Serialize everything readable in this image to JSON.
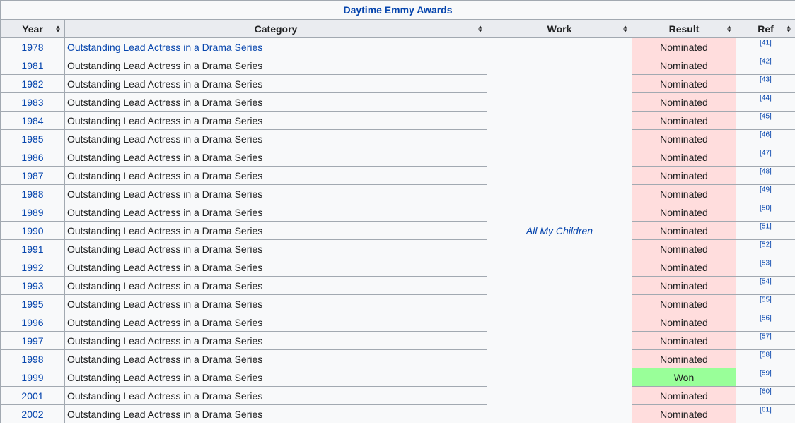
{
  "table": {
    "caption": "Daytime Emmy Awards",
    "headers": [
      "Year",
      "Category",
      "Work",
      "Result",
      "Ref"
    ],
    "work": "All My Children",
    "rows": [
      {
        "year": "1978",
        "category": "Outstanding Lead Actress in a Drama Series",
        "result": "Nominated",
        "ref": "[41]"
      },
      {
        "year": "1981",
        "category": "Outstanding Lead Actress in a Drama Series",
        "result": "Nominated",
        "ref": "[42]"
      },
      {
        "year": "1982",
        "category": "Outstanding Lead Actress in a Drama Series",
        "result": "Nominated",
        "ref": "[43]"
      },
      {
        "year": "1983",
        "category": "Outstanding Lead Actress in a Drama Series",
        "result": "Nominated",
        "ref": "[44]"
      },
      {
        "year": "1984",
        "category": "Outstanding Lead Actress in a Drama Series",
        "result": "Nominated",
        "ref": "[45]"
      },
      {
        "year": "1985",
        "category": "Outstanding Lead Actress in a Drama Series",
        "result": "Nominated",
        "ref": "[46]"
      },
      {
        "year": "1986",
        "category": "Outstanding Lead Actress in a Drama Series",
        "result": "Nominated",
        "ref": "[47]"
      },
      {
        "year": "1987",
        "category": "Outstanding Lead Actress in a Drama Series",
        "result": "Nominated",
        "ref": "[48]"
      },
      {
        "year": "1988",
        "category": "Outstanding Lead Actress in a Drama Series",
        "result": "Nominated",
        "ref": "[49]"
      },
      {
        "year": "1989",
        "category": "Outstanding Lead Actress in a Drama Series",
        "result": "Nominated",
        "ref": "[50]"
      },
      {
        "year": "1990",
        "category": "Outstanding Lead Actress in a Drama Series",
        "result": "Nominated",
        "ref": "[51]"
      },
      {
        "year": "1991",
        "category": "Outstanding Lead Actress in a Drama Series",
        "result": "Nominated",
        "ref": "[52]"
      },
      {
        "year": "1992",
        "category": "Outstanding Lead Actress in a Drama Series",
        "result": "Nominated",
        "ref": "[53]"
      },
      {
        "year": "1993",
        "category": "Outstanding Lead Actress in a Drama Series",
        "result": "Nominated",
        "ref": "[54]"
      },
      {
        "year": "1995",
        "category": "Outstanding Lead Actress in a Drama Series",
        "result": "Nominated",
        "ref": "[55]"
      },
      {
        "year": "1996",
        "category": "Outstanding Lead Actress in a Drama Series",
        "result": "Nominated",
        "ref": "[56]"
      },
      {
        "year": "1997",
        "category": "Outstanding Lead Actress in a Drama Series",
        "result": "Nominated",
        "ref": "[57]"
      },
      {
        "year": "1998",
        "category": "Outstanding Lead Actress in a Drama Series",
        "result": "Nominated",
        "ref": "[58]"
      },
      {
        "year": "1999",
        "category": "Outstanding Lead Actress in a Drama Series",
        "result": "Won",
        "ref": "[59]"
      },
      {
        "year": "2001",
        "category": "Outstanding Lead Actress in a Drama Series",
        "result": "Nominated",
        "ref": "[60]"
      },
      {
        "year": "2002",
        "category": "Outstanding Lead Actress in a Drama Series",
        "result": "Nominated",
        "ref": "[61]"
      }
    ]
  },
  "colors": {
    "link": "#0645ad",
    "header_bg": "#eaecf0",
    "nominated_bg": "#ffdddd",
    "won_bg": "#99ff99",
    "border": "#a2a9b1"
  }
}
